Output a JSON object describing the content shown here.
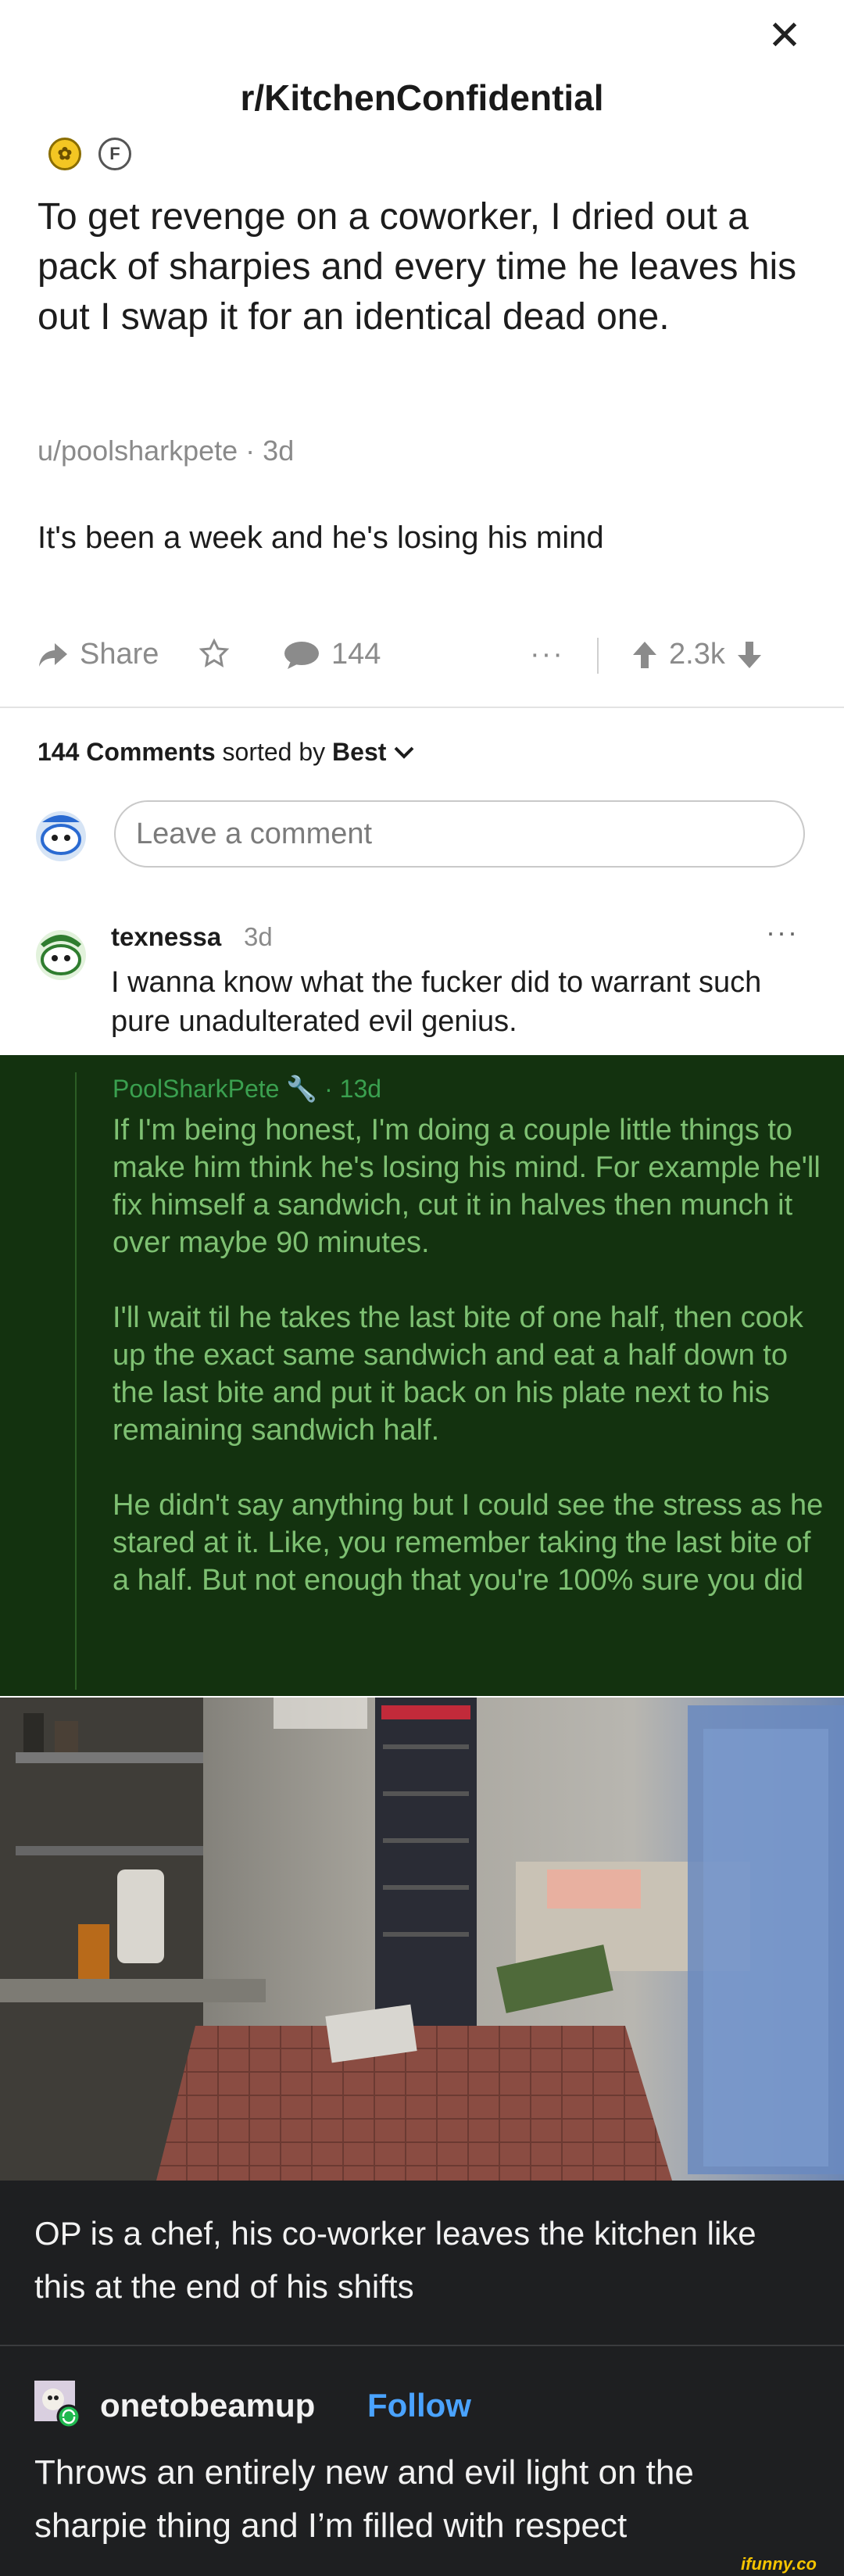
{
  "header": {
    "cutoff_text": "",
    "close_label": "✕"
  },
  "post": {
    "subreddit": "r/KitchenConfidential",
    "flair_letter": "F",
    "title": "To get revenge on a coworker, I dried out a pack of sharpies and every time he leaves his out I swap it for an identical dead one.",
    "author_line": "u/poolsharkpete · 3d",
    "body": "It's been a week and he's losing his mind",
    "share_label": "Share",
    "comment_count": "144",
    "more_label": "···",
    "vote_score": "2.3k"
  },
  "comments": {
    "count_label": "144 Comments",
    "sorted_by": "sorted by",
    "sort_value": "Best",
    "input_placeholder": "Leave a comment",
    "first": {
      "user": "texnessa",
      "time": "3d",
      "text": "I wanna know what the fucker did to warrant such pure unadulterated evil genius."
    },
    "reply": {
      "user_line": "PoolSharkPete 🔧 · 13d",
      "paragraphs": [
        "If I'm being honest, I'm doing a couple little things to make him think he's losing his mind. For example he'll fix himself a sandwich, cut it in halves then munch it over maybe 90 minutes.",
        "I'll wait til he takes the last bite of one half, then cook up the exact same sandwich and eat a half down to the last bite and put it back on his plate next to his remaining sandwich half.",
        "He didn't say anything but I could see the stress as he stared at it. Like, you remember taking the last bite of a half. But not enough that you're 100% sure you did"
      ]
    }
  },
  "tumblr": {
    "op_text": "OP is a chef, his co-worker leaves the kitchen like this at the end of his shifts",
    "username": "onetobeamup",
    "follow_label": "Follow",
    "reblog_text": "Throws an entirely new and evil light on the sharpie thing and I’m filled with respect"
  },
  "watermark": "ifunny.co",
  "colors": {
    "green_bg": "#13320f",
    "reply_text": "#7ec072",
    "dark_bg": "#1e1f21",
    "follow": "#4aa3ff"
  }
}
